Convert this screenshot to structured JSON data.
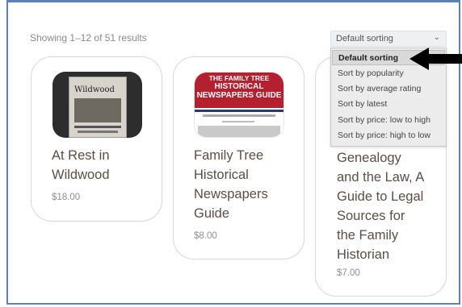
{
  "results_text": "Showing 1–12 of 51 results",
  "sort": {
    "selected": "Default sorting",
    "options": [
      "Default sorting",
      "Sort by popularity",
      "Sort by average rating",
      "Sort by latest",
      "Sort by price: low to high",
      "Sort by price: high to low"
    ]
  },
  "products": [
    {
      "title_lines": [
        "At Rest in",
        "Wildwood"
      ],
      "price": "$18.00",
      "cover_text": "Wildwood"
    },
    {
      "title_lines": [
        "Family Tree",
        "Historical",
        "Newspapers",
        "Guide"
      ],
      "price": "$8.00",
      "cover_lines": [
        "THE FAMILY TREE",
        "HISTORICAL",
        "NEWSPAPERS GUIDE"
      ]
    },
    {
      "title_lines": [
        "Genealogy",
        "and the Law, A",
        "Guide to Legal",
        "Sources for",
        "the Family",
        "Historian"
      ],
      "price": "$7.00"
    }
  ],
  "colors": {
    "frame_border": "#5b7fbf",
    "title_text": "#5b4e46",
    "price_text": "#8f8f8f",
    "cover_red": "#b5202e"
  }
}
